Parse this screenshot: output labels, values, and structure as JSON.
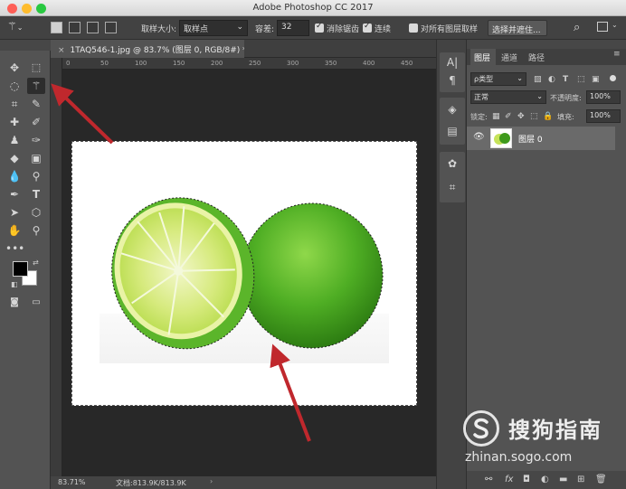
{
  "app": {
    "title": "Adobe Photoshop CC 2017"
  },
  "options_bar": {
    "sample_size_label": "取样大小:",
    "sample_size_value": "取样点",
    "tolerance_label": "容差:",
    "tolerance_value": "32",
    "anti_alias_label": "消除锯齿",
    "anti_alias_checked": true,
    "contiguous_label": "连续",
    "contiguous_checked": true,
    "all_layers_label": "对所有图层取样",
    "all_layers_checked": false,
    "select_mask_button": "选择并遮住..."
  },
  "document": {
    "tab_title": "1TAQ546-1.jpg @ 83.7% (图层 0, RGB/8#) *",
    "ruler_h_ticks": [
      "0",
      "50",
      "100",
      "150",
      "200",
      "250",
      "300",
      "350",
      "400",
      "450"
    ],
    "zoom": "83.71%",
    "doc_size": "文档:813.9K/813.9K"
  },
  "toolbar": {
    "tools": [
      "move-tool",
      "marquee-tool",
      "lasso-tool",
      "magic-wand-tool",
      "crop-tool",
      "eyedropper-tool",
      "healing-tool",
      "brush-tool",
      "stamp-tool",
      "history-brush-tool",
      "eraser-tool",
      "gradient-tool",
      "blur-tool",
      "dodge-tool",
      "pen-tool",
      "type-tool",
      "path-select-tool",
      "shape-tool",
      "hand-tool",
      "zoom-tool"
    ],
    "foreground_color": "#000000",
    "background_color": "#ffffff"
  },
  "layers_panel": {
    "tabs": [
      "图层",
      "通道",
      "路径"
    ],
    "filter_kind": "ρ类型",
    "blend_mode": "正常",
    "opacity_label": "不透明度:",
    "opacity_value": "100%",
    "lock_label": "锁定:",
    "fill_label": "填充:",
    "fill_value": "100%",
    "layers": [
      {
        "name": "图层 0",
        "visible": true
      }
    ]
  },
  "watermark": {
    "brand": "搜狗指南",
    "url": "zhinan.sogo.com"
  },
  "colors": {
    "lime_light": "#c6e35a",
    "lime_dark": "#3f9a1c",
    "annotation_arrow": "#c0282d"
  }
}
